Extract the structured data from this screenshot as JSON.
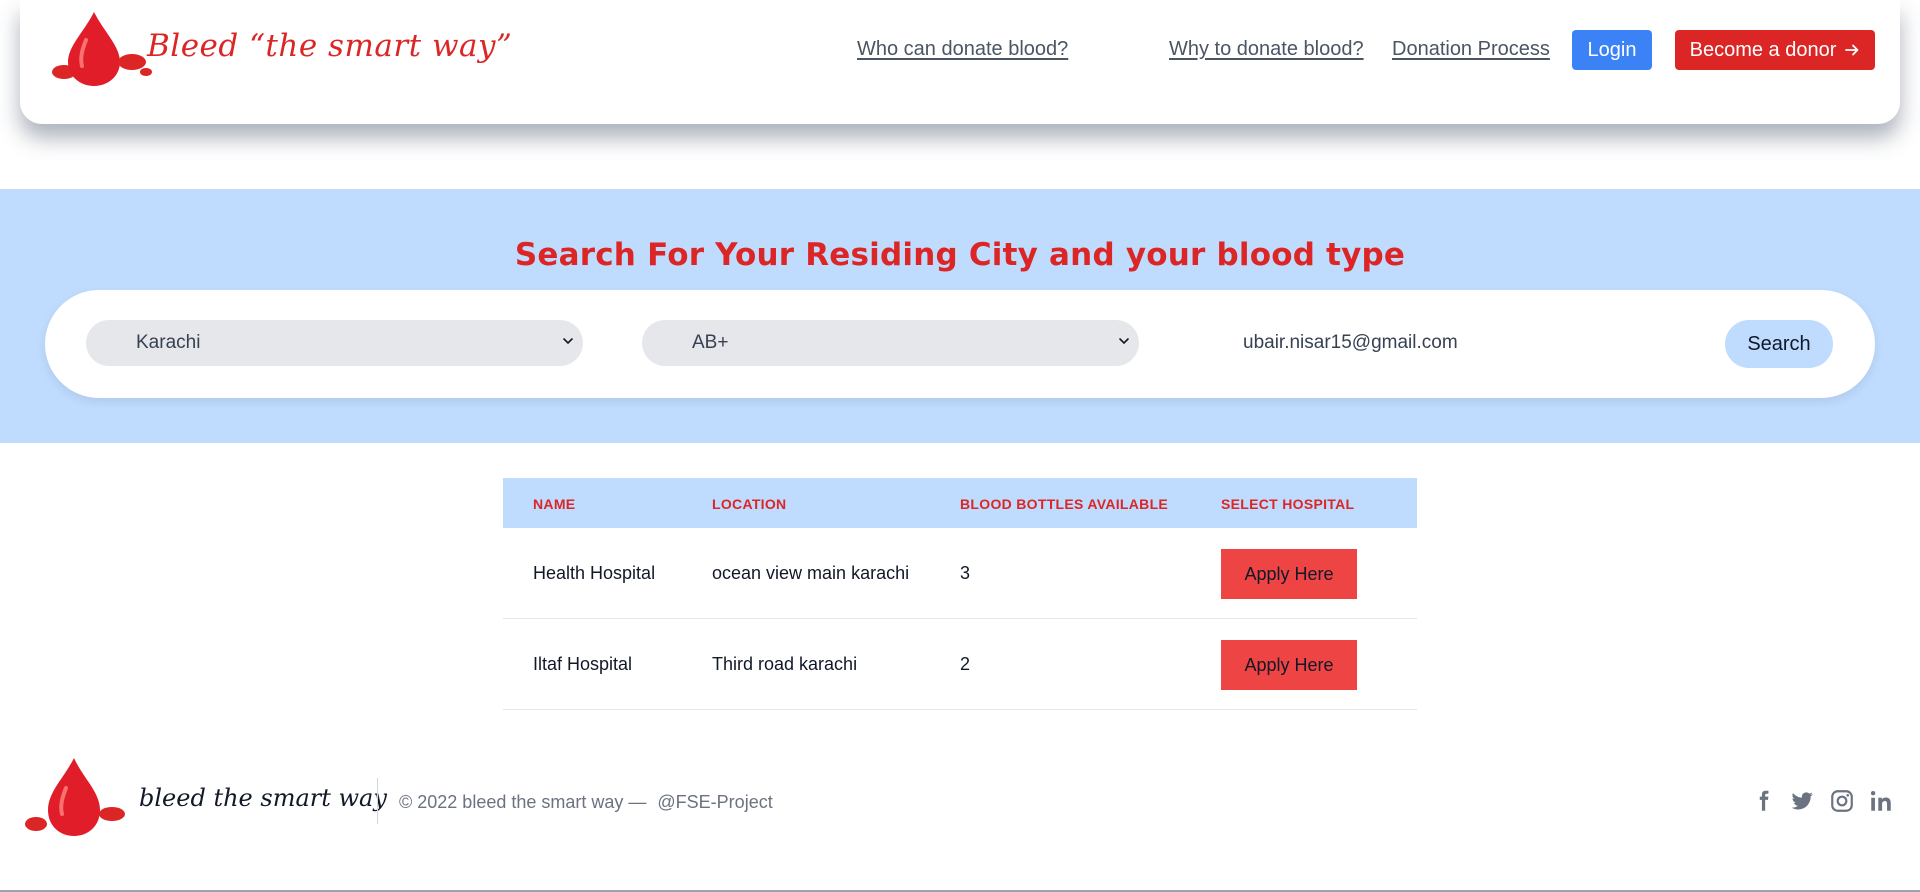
{
  "navbar": {
    "brand": "Bleed “the smart way”",
    "links": [
      {
        "label": "Who can donate blood?"
      },
      {
        "label": "Why to donate blood?"
      },
      {
        "label": "Donation Process"
      }
    ],
    "login_label": "Login",
    "donor_label": "Become a donor"
  },
  "search": {
    "title": "Search For Your Residing City and your blood type",
    "city_value": "Karachi",
    "blood_type_value": "AB+",
    "email_value": "ubair.nisar15@gmail.com",
    "button_label": "Search"
  },
  "table": {
    "headers": [
      "NAME",
      "LOCATION",
      "BLOOD BOTTLES AVAILABLE",
      "SELECT HOSPITAL"
    ],
    "rows": [
      {
        "name": "Health Hospital",
        "location": "ocean view main karachi",
        "bottles": "3",
        "action": "Apply Here"
      },
      {
        "name": "Iltaf Hospital",
        "location": "Third road karachi",
        "bottles": "2",
        "action": "Apply Here"
      }
    ]
  },
  "footer": {
    "brand": "bleed the smart way",
    "copyright": "© 2022 bleed the smart way —",
    "handle": "@FSE-Project",
    "social_icons": [
      "facebook-icon",
      "twitter-icon",
      "instagram-icon",
      "linkedin-icon"
    ]
  },
  "colors": {
    "brand_red": "#dc2626",
    "accent_blue": "#3b82f6",
    "band_blue": "#bfdbfe",
    "apply_red": "#ef4444"
  }
}
